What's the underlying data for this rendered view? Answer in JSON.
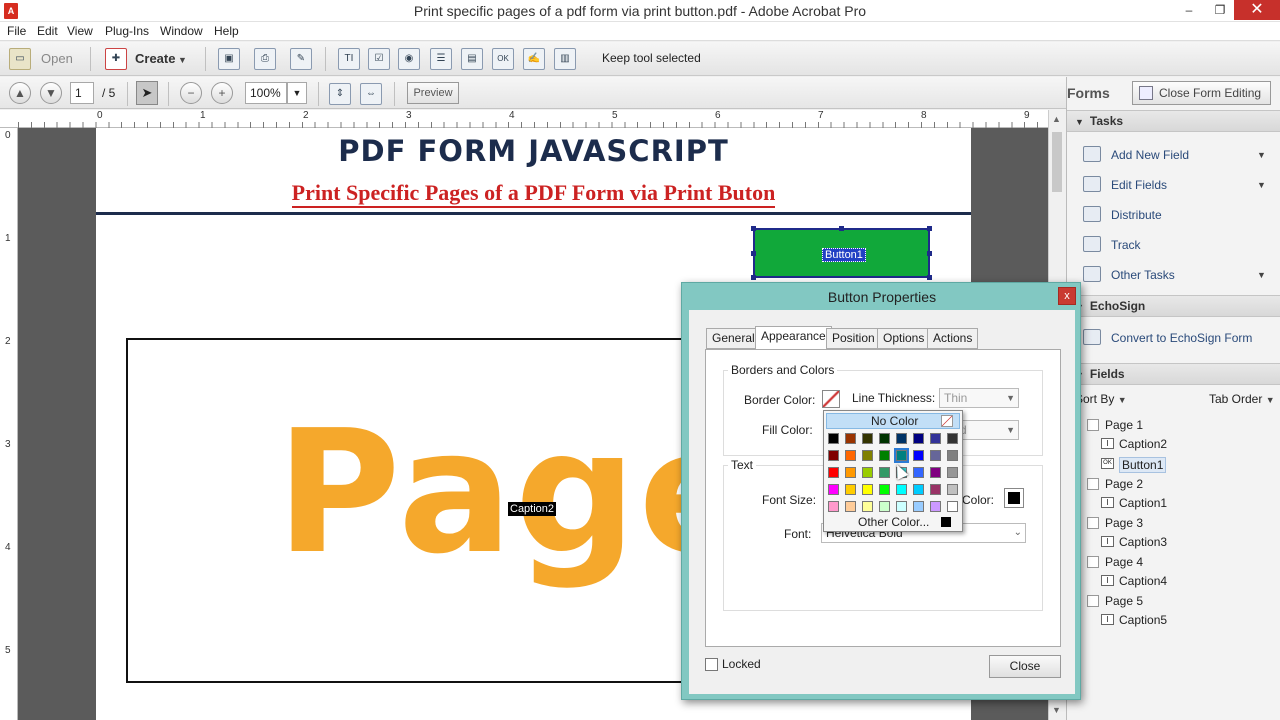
{
  "window": {
    "title": "Print specific pages of a pdf form via print button.pdf - Adobe Acrobat Pro",
    "min": "–",
    "max": "❐",
    "close": "✕"
  },
  "menu": [
    "File",
    "Edit",
    "View",
    "Plug-Ins",
    "Window",
    "Help"
  ],
  "toolbar1": {
    "open_label": "Open",
    "create_label": "Create",
    "keep_tool_label": "Keep tool selected"
  },
  "toolbar2": {
    "page_current": "1",
    "page_total": "/ 5",
    "zoom": "100%",
    "preview_label": "Preview"
  },
  "ruler": {
    "h": [
      "0",
      "1",
      "2",
      "3",
      "4",
      "5",
      "6",
      "7",
      "8",
      "9"
    ],
    "v": [
      "0",
      "1",
      "2",
      "3",
      "4",
      "5"
    ]
  },
  "document": {
    "title": "PDF FORM JAVASCRIPT",
    "subtitle": "Print Specific Pages of a PDF Form via Print Buton",
    "button1_label": "Button1",
    "big_word": "Page",
    "caption2_label": "Caption2"
  },
  "right_panel": {
    "forms_label": "Forms",
    "close_form_editing": "Close Form Editing",
    "tasks_header": "Tasks",
    "tasks": [
      "Add New Field",
      "Edit Fields",
      "Distribute",
      "Track",
      "Other Tasks"
    ],
    "echosign_header": "EchoSign",
    "echosign_item": "Convert to EchoSign Form",
    "fields_header": "Fields",
    "sort_by": "Sort By",
    "tab_order": "Tab Order",
    "tree": [
      {
        "label": "Page 1",
        "level": 0
      },
      {
        "label": "Caption2",
        "level": 1
      },
      {
        "label": "Button1",
        "level": 1
      },
      {
        "label": "Page 2",
        "level": 0
      },
      {
        "label": "Caption1",
        "level": 1
      },
      {
        "label": "Page 3",
        "level": 0
      },
      {
        "label": "Caption3",
        "level": 1
      },
      {
        "label": "Page 4",
        "level": 0
      },
      {
        "label": "Caption4",
        "level": 1
      },
      {
        "label": "Page 5",
        "level": 0
      },
      {
        "label": "Caption5",
        "level": 1
      }
    ]
  },
  "dialog": {
    "title": "Button Properties",
    "close_x": "x",
    "tabs": [
      "General",
      "Appearance",
      "Position",
      "Options",
      "Actions"
    ],
    "active_tab": "Appearance",
    "borders_group": "Borders and Colors",
    "border_color_label": "Border Color:",
    "line_thickness_label": "Line Thickness:",
    "line_thickness_value": "Thin",
    "fill_color_label": "Fill Color:",
    "line_style_value_partial": "d",
    "text_group": "Text",
    "font_size_label": "Font Size:",
    "text_color_label": "Color:",
    "font_label": "Font:",
    "font_value": "Helvetica Bold",
    "locked_label": "Locked",
    "close_button": "Close"
  },
  "color_picker": {
    "no_color": "No Color",
    "other_color": "Other Color...",
    "colors": [
      [
        "#000000",
        "#993300",
        "#333300",
        "#003300",
        "#003366",
        "#000080",
        "#333399",
        "#333333"
      ],
      [
        "#800000",
        "#ff6600",
        "#808000",
        "#008000",
        "#008080",
        "#0000ff",
        "#666699",
        "#808080"
      ],
      [
        "#ff0000",
        "#ff9900",
        "#99cc00",
        "#339966",
        "#33cccc",
        "#3366ff",
        "#800080",
        "#969696"
      ],
      [
        "#ff00ff",
        "#ffcc00",
        "#ffff00",
        "#00ff00",
        "#00ffff",
        "#00ccff",
        "#993366",
        "#c0c0c0"
      ],
      [
        "#ff99cc",
        "#ffcc99",
        "#ffff99",
        "#ccffcc",
        "#ccffff",
        "#99ccff",
        "#cc99ff",
        "#ffffff"
      ]
    ]
  },
  "colors": {
    "title_navy": "#1c2c4c",
    "subtitle_red": "#cc2222",
    "page_orange": "#f5a82c",
    "button_green": "#11a83a",
    "dialog_teal": "#82c8c2"
  }
}
